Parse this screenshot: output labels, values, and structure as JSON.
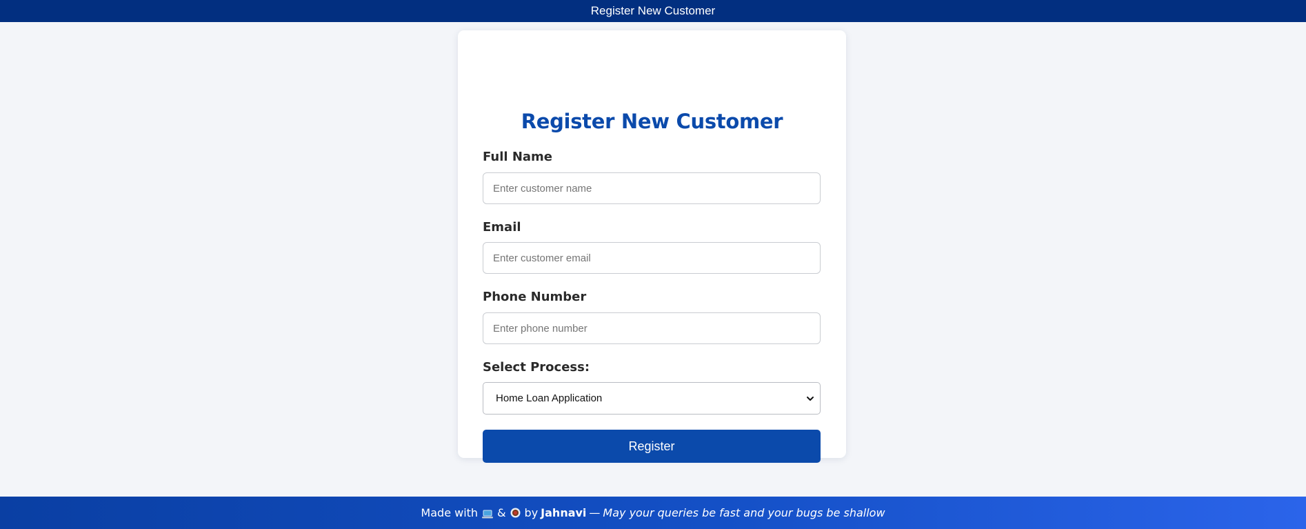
{
  "header": {
    "title": "Register New Customer"
  },
  "form": {
    "title": "Register New Customer",
    "full_name": {
      "label": "Full Name",
      "placeholder": "Enter customer name",
      "value": ""
    },
    "email": {
      "label": "Email",
      "placeholder": "Enter customer email",
      "value": ""
    },
    "phone": {
      "label": "Phone Number",
      "placeholder": "Enter phone number",
      "value": ""
    },
    "process": {
      "label": "Select Process:",
      "selected": "Home Loan Application"
    },
    "submit_label": "Register"
  },
  "footer": {
    "prefix": "Made with",
    "icon_1": "laptop-icon",
    "ampersand": "&",
    "icon_2": "coffee-icon",
    "by": "by",
    "author": "Jahnavi",
    "dash": "—",
    "tagline": "May your queries be fast and your bugs be shallow"
  },
  "colors": {
    "header_bg": "#022f80",
    "accent": "#0b4aab",
    "page_bg": "#f3f5f9",
    "footer_gradient_start": "#0a3fa3",
    "footer_gradient_end": "#2b64ea"
  }
}
